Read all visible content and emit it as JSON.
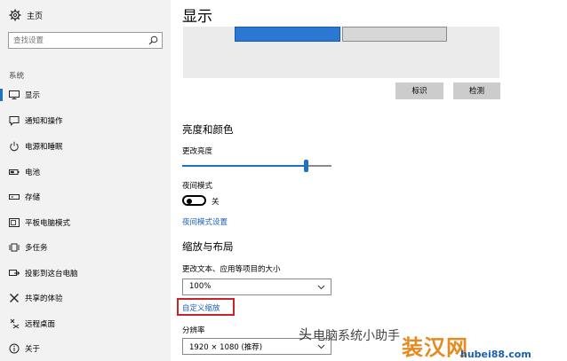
{
  "sidebar": {
    "home_label": "主页",
    "search_placeholder": "查找设置",
    "section_label": "系统",
    "items": [
      {
        "label": "显示",
        "icon": "monitor-icon",
        "active": true
      },
      {
        "label": "通知和操作",
        "icon": "message-icon"
      },
      {
        "label": "电源和睡眠",
        "icon": "power-icon"
      },
      {
        "label": "电池",
        "icon": "battery-icon"
      },
      {
        "label": "存储",
        "icon": "storage-icon"
      },
      {
        "label": "平板电脑模式",
        "icon": "tablet-icon"
      },
      {
        "label": "多任务",
        "icon": "multitask-icon"
      },
      {
        "label": "投影到这台电脑",
        "icon": "project-icon"
      },
      {
        "label": "共享的体验",
        "icon": "share-icon"
      },
      {
        "label": "远程桌面",
        "icon": "remote-icon"
      },
      {
        "label": "关于",
        "icon": "info-icon"
      }
    ]
  },
  "main": {
    "title": "显示",
    "identify_label": "标识",
    "detect_label": "检测",
    "brightness_heading": "亮度和颜色",
    "brightness_label": "更改亮度",
    "brightness_value": 0.83,
    "night_label": "夜间模式",
    "night_state": "关",
    "night_link": "夜间模式设置",
    "scale_heading": "缩放与布局",
    "scale_label": "更改文本、应用等项目的大小",
    "scale_value": "100%",
    "custom_scale_link": "自定义缩放",
    "resolution_label": "分辨率",
    "resolution_value": "1920 × 1080 (推荐)"
  },
  "watermark": {
    "tou": "头",
    "mid": "电脑系统小助手",
    "brand": "装汉网",
    "url": "hubei88.com"
  },
  "colors": {
    "accent": "#1a73c6",
    "highlight": "#c8232b",
    "sidebar_bg": "#f2f2f2"
  }
}
